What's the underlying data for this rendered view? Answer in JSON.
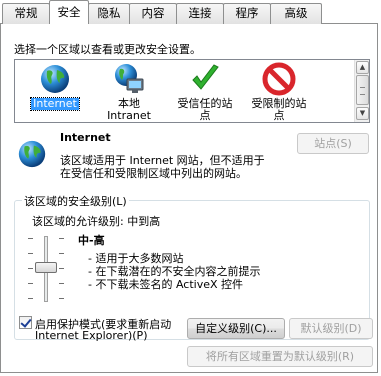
{
  "tabs": [
    {
      "label": "常规"
    },
    {
      "label": "安全"
    },
    {
      "label": "隐私"
    },
    {
      "label": "内容"
    },
    {
      "label": "连接"
    },
    {
      "label": "程序"
    },
    {
      "label": "高级"
    }
  ],
  "active_tab": "安全",
  "zone_prompt": "选择一个区域以查看或更改安全设置。",
  "zones": [
    {
      "name": "Internet",
      "icon": "globe-icon"
    },
    {
      "name": "本地 Intranet",
      "line1": "本地",
      "line2": "Intranet",
      "icon": "local-intranet-icon"
    },
    {
      "name": "受信任的站点",
      "line1": "受信任的站",
      "line2": "点",
      "icon": "green-check-icon"
    },
    {
      "name": "受限制的站点",
      "line1": "受限制的站",
      "line2": "点",
      "icon": "red-forbidden-icon"
    }
  ],
  "selected_zone": {
    "title": "Internet",
    "desc_line1": "该区域适用于 Internet 网站，但不适用于",
    "desc_line2": "在受信任和受限制区域中列出的网站。",
    "sites_button": "站点(S)"
  },
  "security_level": {
    "group_title": "该区域的安全级别(L)",
    "allowed_levels": "该区域的允许级别: 中到高",
    "level_name": "中-高",
    "bullets": [
      "- 适用于大多数网站",
      "- 在下载潜在的不安全内容之前提示",
      "- 不下载未签名的 ActiveX 控件"
    ],
    "level_fraction": 0.5
  },
  "protected_mode": {
    "label_line1": "启用保护模式(要求重新启动",
    "label_line2": "Internet Explorer)(P)",
    "checked": true
  },
  "buttons": {
    "custom_level": "自定义级别(C)...",
    "default_level": "默认级别(D)",
    "reset_all": "将所有区域重置为默认级别(R)"
  },
  "colors": {
    "selection": "#3399ff",
    "trusted_check": "#2fb12f",
    "restricted": "#d9262c"
  }
}
